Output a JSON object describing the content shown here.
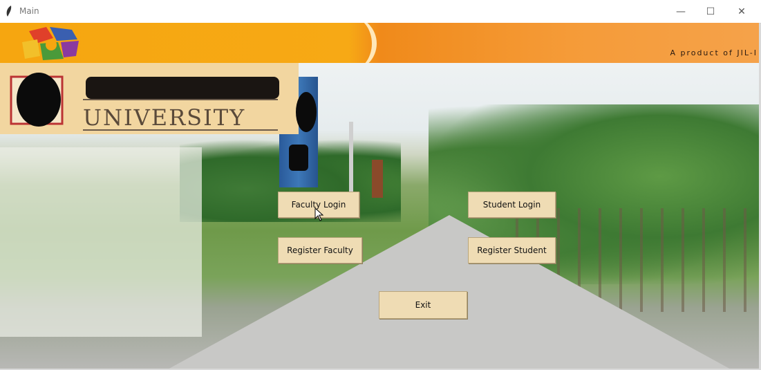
{
  "window": {
    "title": "Main",
    "controls": {
      "minimize": "—",
      "maximize": "☐",
      "close": "✕"
    }
  },
  "banner": {
    "tagline": "A product of JIL-I"
  },
  "university": {
    "name_line": "UNIVERSITY"
  },
  "buttons": {
    "faculty_login": "Faculty Login",
    "student_login": "Student Login",
    "register_faculty": "Register Faculty",
    "register_student": "Register Student",
    "exit": "Exit"
  },
  "icons": [
    "feather-icon",
    "logo-icon",
    "university-emblem-icon",
    "cursor-icon"
  ],
  "colors": {
    "button_bg": "#efdcb4",
    "header_bg": "#f2d6a0",
    "orange_bar": "#f6a610"
  }
}
